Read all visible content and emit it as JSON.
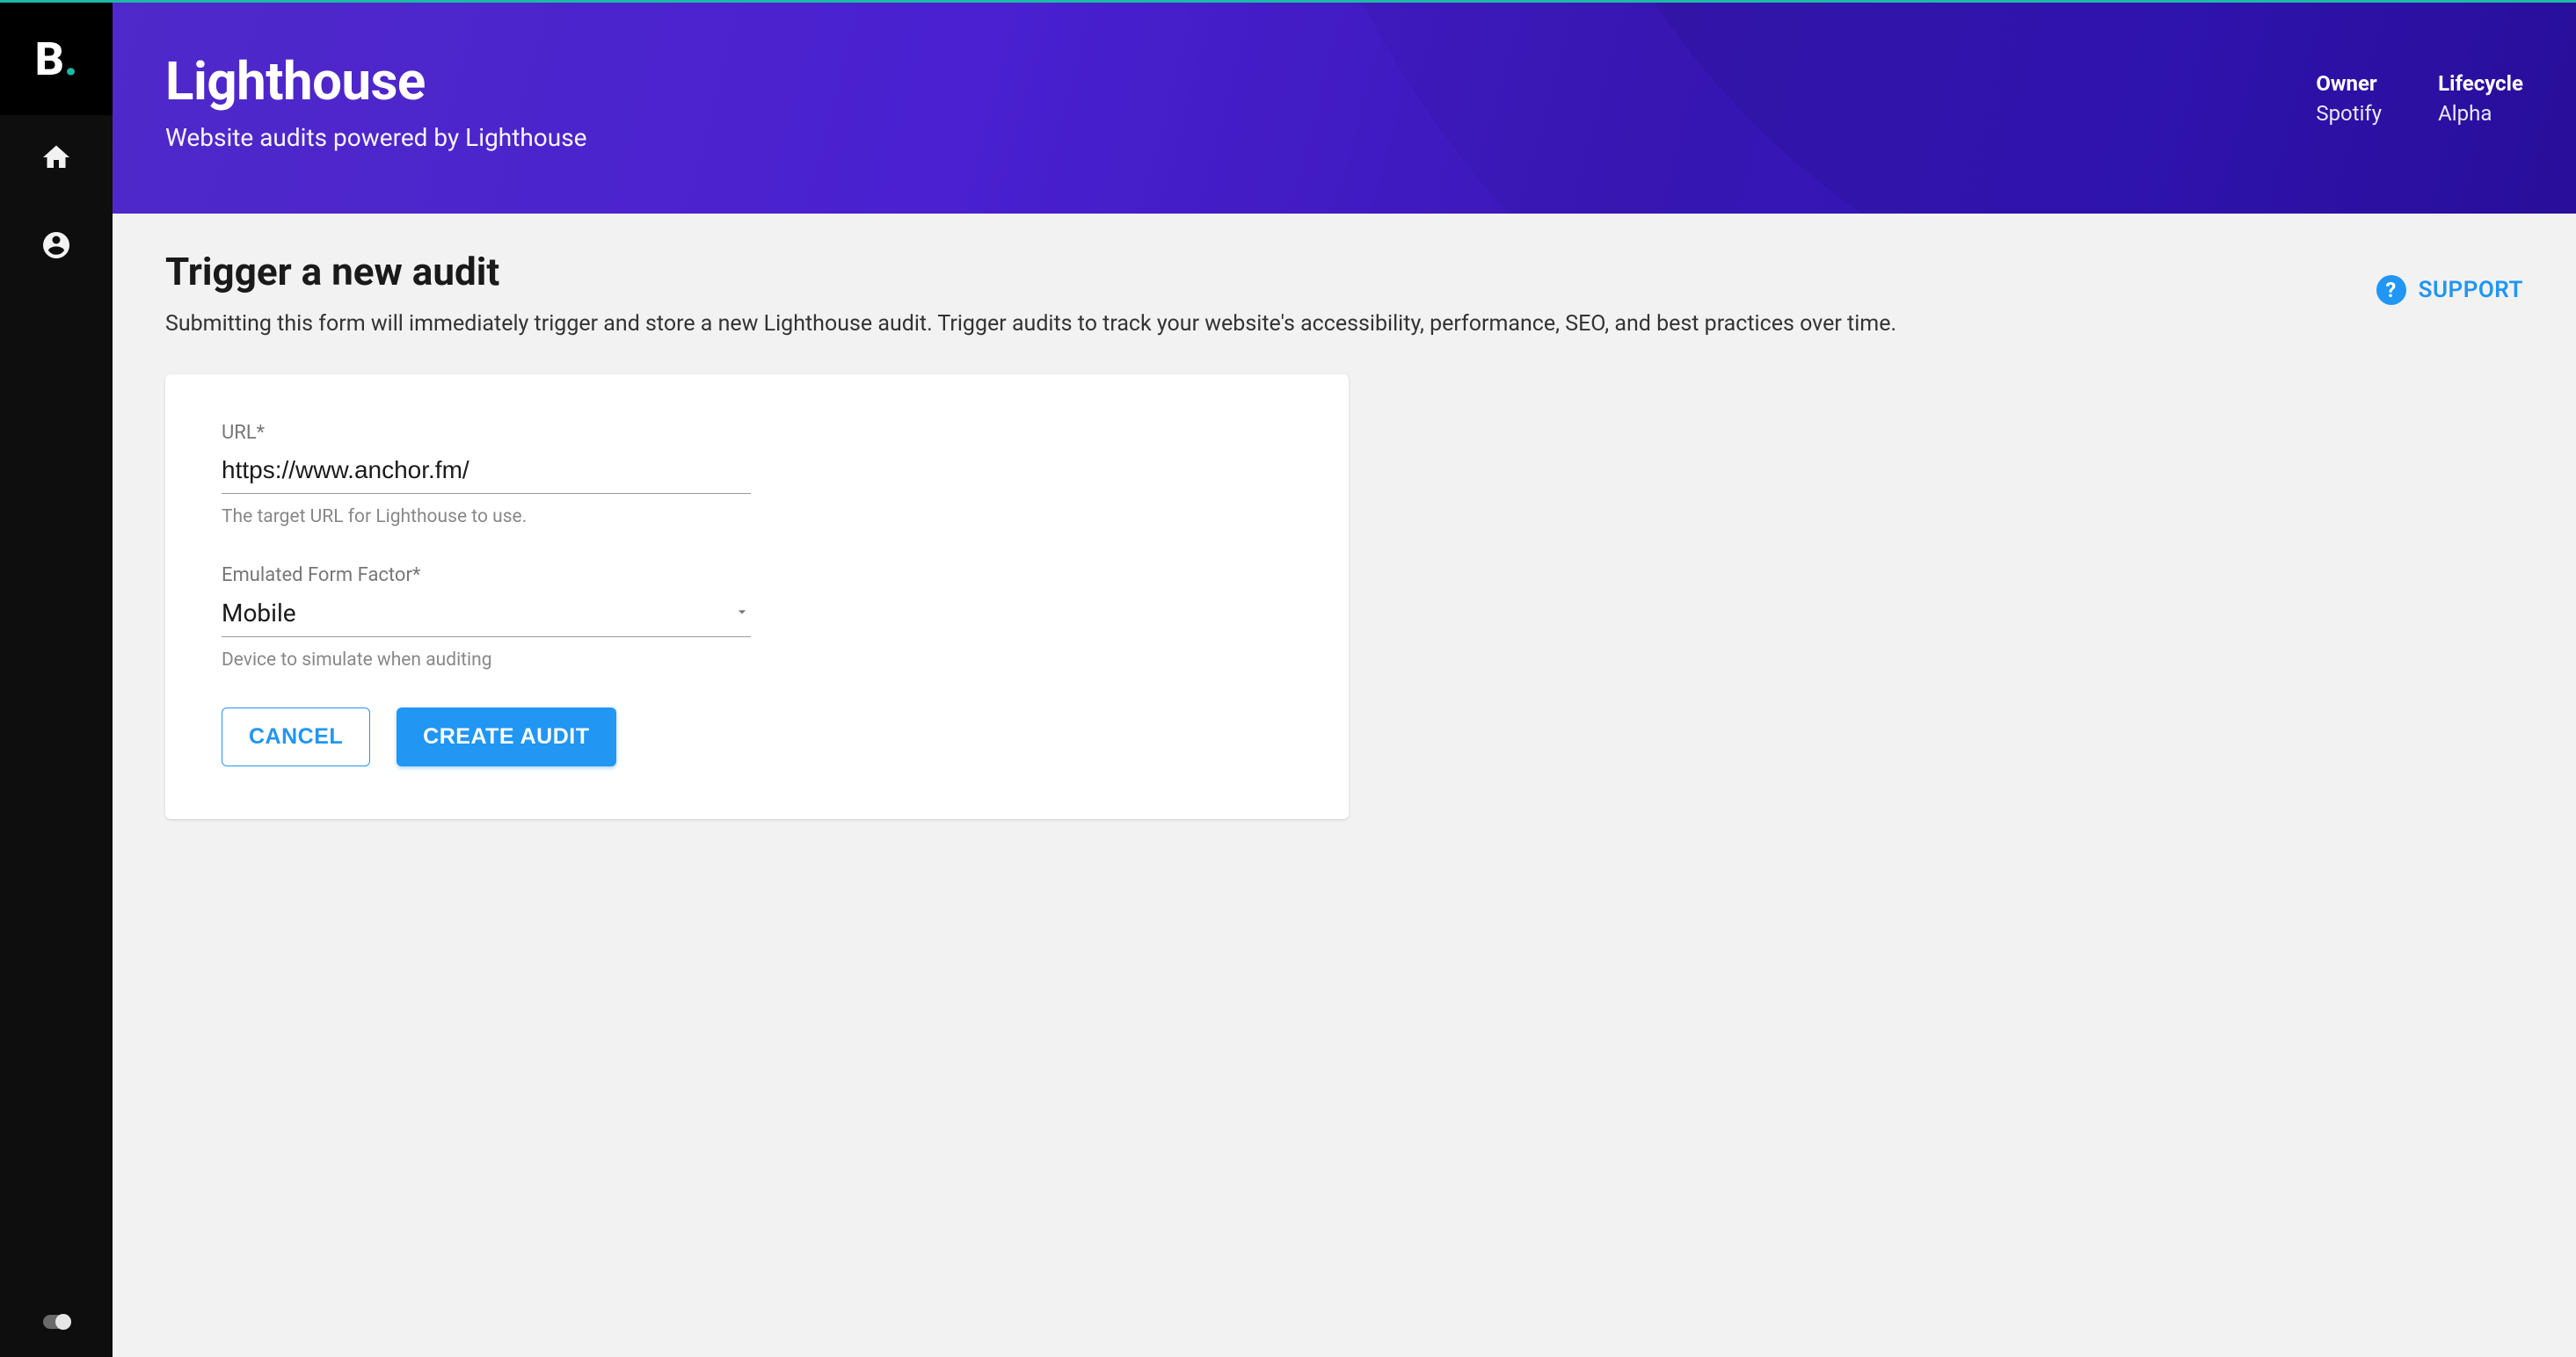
{
  "sidebar": {
    "logo_letter": "B",
    "logo_dot": "."
  },
  "header": {
    "title": "Lighthouse",
    "subtitle": "Website audits powered by Lighthouse",
    "meta": [
      {
        "label": "Owner",
        "value": "Spotify"
      },
      {
        "label": "Lifecycle",
        "value": "Alpha"
      }
    ]
  },
  "support": {
    "label": "SUPPORT",
    "icon_glyph": "?"
  },
  "page": {
    "title": "Trigger a new audit",
    "description": "Submitting this form will immediately trigger and store a new Lighthouse audit. Trigger audits to track your website's accessibility, performance, SEO, and best practices over time."
  },
  "form": {
    "url": {
      "label": "URL*",
      "value": "https://www.anchor.fm/",
      "helper": "The target URL for Lighthouse to use."
    },
    "form_factor": {
      "label": "Emulated Form Factor*",
      "value": "Mobile",
      "helper": "Device to simulate when auditing"
    },
    "cancel_label": "CANCEL",
    "submit_label": "CREATE AUDIT"
  }
}
